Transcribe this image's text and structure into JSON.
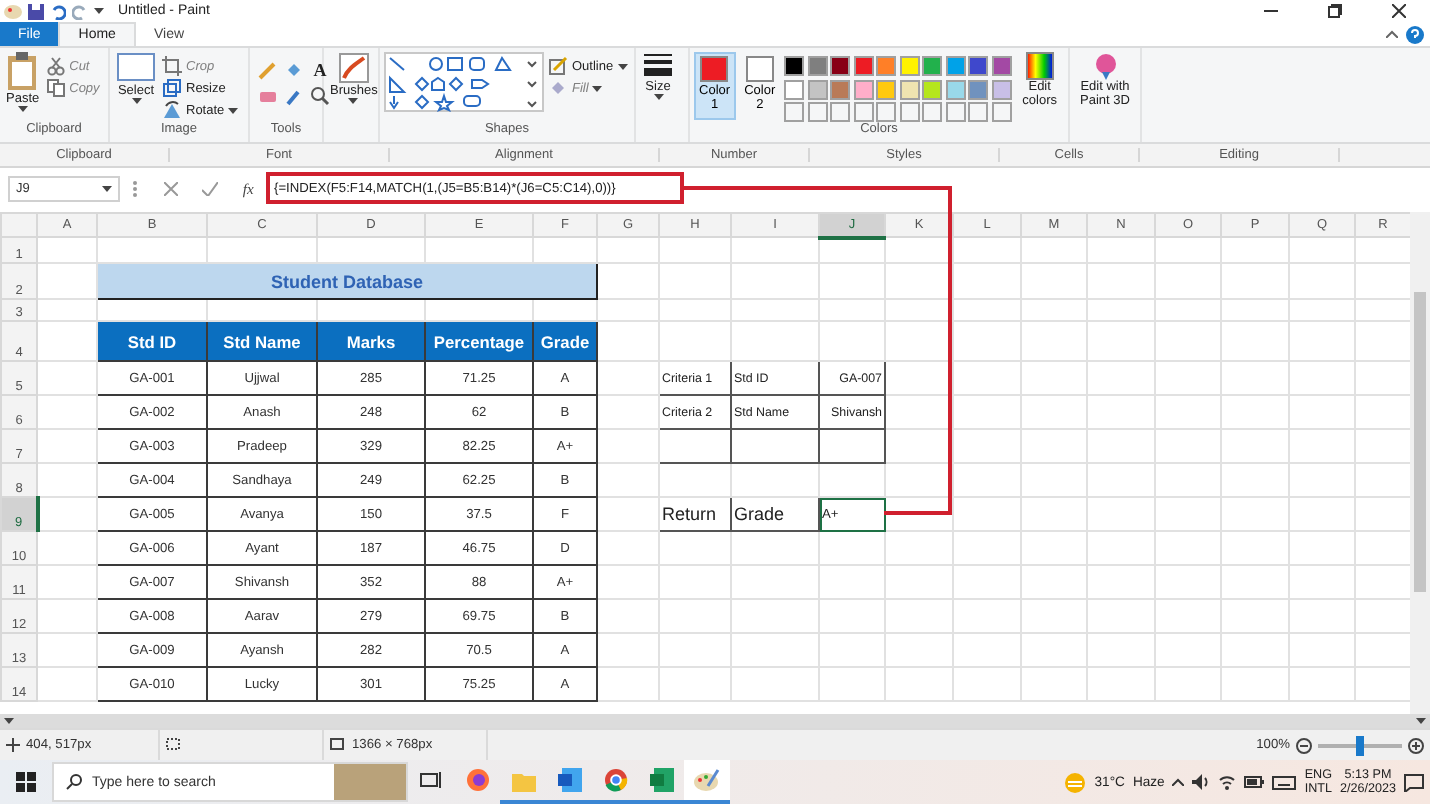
{
  "titlebar": {
    "title": "Untitled - Paint"
  },
  "tabs": [
    {
      "label": "File",
      "kind": "file",
      "selected": false
    },
    {
      "label": "Home",
      "kind": "tab",
      "selected": true
    },
    {
      "label": "View",
      "kind": "tab",
      "selected": false
    }
  ],
  "ribbon": [
    {
      "kind": "clipboard",
      "label": "Clipboard",
      "big": "Paste",
      "small": [
        {
          "kind": "cut",
          "label": "Cut",
          "disabled": true
        },
        {
          "kind": "copy",
          "label": "Copy",
          "disabled": true
        }
      ]
    },
    {
      "kind": "image",
      "label": "Image",
      "big": "Select",
      "small": [
        {
          "kind": "crop",
          "label": "Crop",
          "disabled": true
        },
        {
          "kind": "resize",
          "label": "Resize",
          "disabled": false
        },
        {
          "kind": "rotate",
          "label": "Rotate",
          "disabled": false
        }
      ]
    },
    {
      "kind": "tools",
      "label": "Tools",
      "glyph": "A"
    },
    {
      "kind": "brushes",
      "big": "Brushes"
    },
    {
      "kind": "shapes",
      "label": "Shapes",
      "small": [
        {
          "kind": "outline",
          "label": "Outline",
          "disabled": false
        },
        {
          "kind": "fill",
          "label": "Fill",
          "disabled": true
        }
      ]
    },
    {
      "kind": "size",
      "big": "Size"
    },
    {
      "kind": "colors",
      "label": "Colors",
      "slots": [
        {
          "label": "Color 1",
          "color": "#ed1c24",
          "selected": true
        },
        {
          "label": "Color 2",
          "color": "#ffffff",
          "selected": false
        }
      ],
      "palette": [
        {
          "color": "#000000"
        },
        {
          "color": "#7f7f7f"
        },
        {
          "color": "#880015"
        },
        {
          "color": "#ed1c24"
        },
        {
          "color": "#ff7f27"
        },
        {
          "color": "#fff200"
        },
        {
          "color": "#22b14c"
        },
        {
          "color": "#00a2e8"
        },
        {
          "color": "#3f48cc"
        },
        {
          "color": "#a349a4"
        },
        {
          "color": "#ffffff"
        },
        {
          "color": "#c3c3c3"
        },
        {
          "color": "#b97a57"
        },
        {
          "color": "#ffaec9"
        },
        {
          "color": "#ffc90e"
        },
        {
          "color": "#efe4b0"
        },
        {
          "color": "#b5e61d"
        },
        {
          "color": "#99d9ea"
        },
        {
          "color": "#7092be"
        },
        {
          "color": "#c8bfe7"
        }
      ],
      "edit": "Edit colors"
    },
    {
      "kind": "paint3d",
      "big": "Edit with Paint 3D"
    }
  ],
  "sheet": {
    "ribbon_groups": [
      "Clipboard",
      "Font",
      "Alignment",
      "Number",
      "Styles",
      "Cells",
      "Editing"
    ],
    "name_box": "J9",
    "function_label": "fx",
    "formula": "{=INDEX(F5:F14,MATCH(1,(J5=B5:B14)*(J6=C5:C14),0))}",
    "columns": [
      {
        "label": "A",
        "selected": false
      },
      {
        "label": "B",
        "selected": false
      },
      {
        "label": "C",
        "selected": false
      },
      {
        "label": "D",
        "selected": false
      },
      {
        "label": "E",
        "selected": false
      },
      {
        "label": "F",
        "selected": false
      },
      {
        "label": "G",
        "selected": false
      },
      {
        "label": "H",
        "selected": false
      },
      {
        "label": "I",
        "selected": false
      },
      {
        "label": "J",
        "selected": true
      },
      {
        "label": "K",
        "selected": false
      },
      {
        "label": "L",
        "selected": false
      },
      {
        "label": "M",
        "selected": false
      },
      {
        "label": "N",
        "selected": false
      },
      {
        "label": "O",
        "selected": false
      },
      {
        "label": "P",
        "selected": false
      },
      {
        "label": "Q",
        "selected": false
      },
      {
        "label": "R",
        "selected": false
      }
    ],
    "rows": [
      {
        "label": "1",
        "selected": false
      },
      {
        "label": "2",
        "selected": false
      },
      {
        "label": "3",
        "selected": false
      },
      {
        "label": "4",
        "selected": false
      },
      {
        "label": "5",
        "selected": false
      },
      {
        "label": "6",
        "selected": false
      },
      {
        "label": "7",
        "selected": false
      },
      {
        "label": "8",
        "selected": false
      },
      {
        "label": "9",
        "selected": true
      },
      {
        "label": "10",
        "selected": false
      },
      {
        "label": "11",
        "selected": false
      },
      {
        "label": "12",
        "selected": false
      },
      {
        "label": "13",
        "selected": false
      },
      {
        "label": "14",
        "selected": false
      }
    ],
    "title": "Student Database",
    "table": {
      "columns": [
        "Std ID",
        "Std Name",
        "Marks",
        "Percentage",
        "Grade"
      ],
      "rows": [
        [
          "GA-001",
          "Ujjwal",
          "285",
          "71.25",
          "A"
        ],
        [
          "GA-002",
          "Anash",
          "248",
          "62",
          "B"
        ],
        [
          "GA-003",
          "Pradeep",
          "329",
          "82.25",
          "A+"
        ],
        [
          "GA-004",
          "Sandhaya",
          "249",
          "62.25",
          "B"
        ],
        [
          "GA-005",
          "Avanya",
          "150",
          "37.5",
          "F"
        ],
        [
          "GA-006",
          "Ayant",
          "187",
          "46.75",
          "D"
        ],
        [
          "GA-007",
          "Shivansh",
          "352",
          "88",
          "A+"
        ],
        [
          "GA-008",
          "Aarav",
          "279",
          "69.75",
          "B"
        ],
        [
          "GA-009",
          "Ayansh",
          "282",
          "70.5",
          "A"
        ],
        [
          "GA-010",
          "Lucky",
          "301",
          "75.25",
          "A"
        ]
      ]
    },
    "criteria": [
      [
        "Criteria 1",
        "Std ID",
        "GA-007"
      ],
      [
        "Criteria 2",
        "Std Name",
        "Shivansh"
      ]
    ],
    "result": [
      "Return",
      "Grade",
      "A+"
    ]
  },
  "status": {
    "cursor": "404, 517px",
    "canvas_size": "1366 × 768px",
    "zoom": "100%",
    "zoom_slider": {
      "level": 0.5
    }
  },
  "taskbar": {
    "search_placeholder": "Type here to search",
    "apps": [
      {
        "kind": "taskview",
        "running": false,
        "selected": false
      },
      {
        "kind": "firefox",
        "running": false,
        "selected": false
      },
      {
        "kind": "folder",
        "running": true,
        "selected": false
      },
      {
        "kind": "word",
        "running": true,
        "selected": false
      },
      {
        "kind": "chrome",
        "running": true,
        "selected": false
      },
      {
        "kind": "excel",
        "running": true,
        "selected": false
      },
      {
        "kind": "paint",
        "running": true,
        "selected": true
      }
    ],
    "temperature": "31°C",
    "weather": "Haze",
    "language": [
      "ENG",
      "INTL"
    ],
    "time": "5:13 PM",
    "date": "2/26/2023"
  }
}
